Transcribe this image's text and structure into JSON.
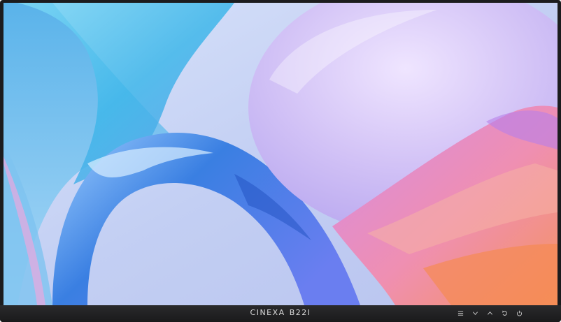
{
  "monitor": {
    "brand": "CINEXA",
    "model": "B22I"
  },
  "wallpaper": {
    "description_colors": {
      "background": "#c8d4f2",
      "blue_ribbon": "#3a8be0",
      "cyan_ribbon": "#55c8ef",
      "violet_orb": "#c9b5f3",
      "orange_glow": "#f19166",
      "pink_glow": "#e27bd4"
    }
  },
  "controls": [
    {
      "name": "menu-button",
      "icon": "menu-icon"
    },
    {
      "name": "down-button",
      "icon": "chevron-down-icon"
    },
    {
      "name": "up-button",
      "icon": "chevron-up-icon"
    },
    {
      "name": "back-button",
      "icon": "return-icon"
    },
    {
      "name": "power-button",
      "icon": "power-icon"
    }
  ]
}
